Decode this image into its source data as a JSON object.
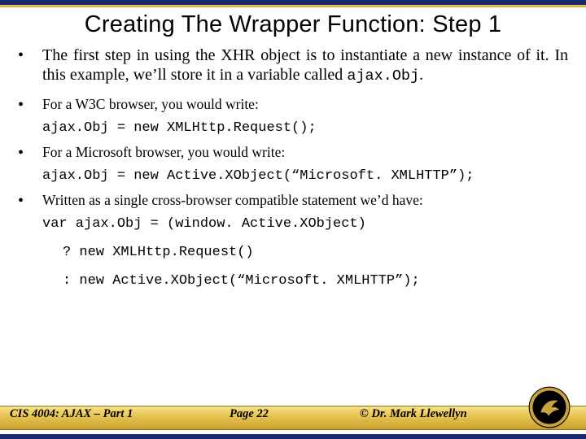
{
  "title": "Creating The Wrapper Function: Step 1",
  "bullets": {
    "b1_pre": "The first step in using the XHR object is to instantiate a new instance of it.  In this example, we’ll store it in a variable called ",
    "b1_code": "ajax.Obj",
    "b1_post": ".",
    "b2": "For a W3C browser, you would write:",
    "c2": "ajax.Obj = new XMLHttp.Request();",
    "b3": "For a Microsoft browser, you would write:",
    "c3": "ajax.Obj = new Active.XObject(“Microsoft. XMLHTTP”);",
    "b4": "Written as a single cross-browser compatible statement we’d have:",
    "c4a": "var ajax.Obj = (window. Active.XObject)",
    "c4b": "? new XMLHttp.Request()",
    "c4c": ": new Active.XObject(“Microsoft. XMLHTTP”);"
  },
  "footer": {
    "left": "CIS 4004: AJAX – Part 1",
    "mid": "Page 22",
    "right": "© Dr. Mark Llewellyn"
  }
}
